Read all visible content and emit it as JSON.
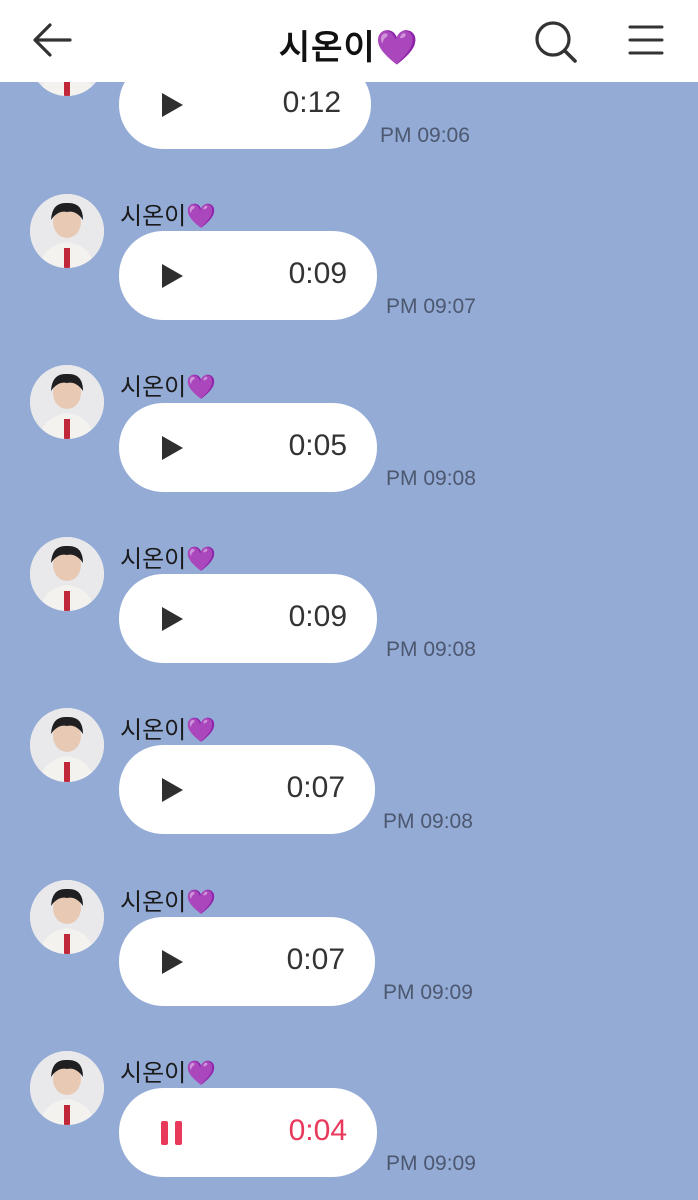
{
  "header": {
    "title": "시온이",
    "title_emoji": "💜",
    "back_icon": "arrow-left-icon",
    "search_icon": "search-icon",
    "menu_icon": "hamburger-menu-icon"
  },
  "colors": {
    "background": "#93abd5",
    "header_bg": "#ffffff",
    "bubble_bg": "#ffffff",
    "active_accent": "#e8395a",
    "heart": "#9b3fe0"
  },
  "messages": [
    {
      "sender": "",
      "sender_emoji": "",
      "duration": "0:12",
      "time": "PM 09:06",
      "state": "play"
    },
    {
      "sender": "시온이",
      "sender_emoji": "💜",
      "duration": "0:09",
      "time": "PM 09:07",
      "state": "play"
    },
    {
      "sender": "시온이",
      "sender_emoji": "💜",
      "duration": "0:05",
      "time": "PM 09:08",
      "state": "play"
    },
    {
      "sender": "시온이",
      "sender_emoji": "💜",
      "duration": "0:09",
      "time": "PM 09:08",
      "state": "play"
    },
    {
      "sender": "시온이",
      "sender_emoji": "💜",
      "duration": "0:07",
      "time": "PM 09:08",
      "state": "play"
    },
    {
      "sender": "시온이",
      "sender_emoji": "💜",
      "duration": "0:07",
      "time": "PM 09:09",
      "state": "play"
    },
    {
      "sender": "시온이",
      "sender_emoji": "💜",
      "duration": "0:04",
      "time": "PM 09:09",
      "state": "pause"
    }
  ]
}
